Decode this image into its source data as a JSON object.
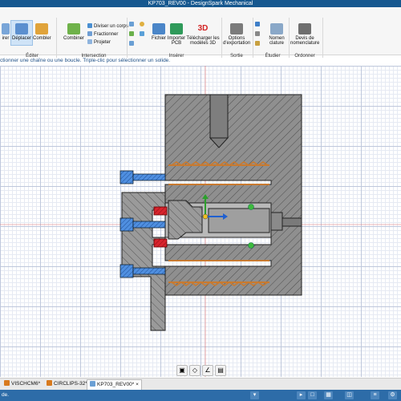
{
  "window": {
    "title": "KP703_REV00 - DesignSpark Mechanical"
  },
  "ribbon": {
    "edit": {
      "tools": [
        {
          "label": "irer"
        },
        {
          "label": "Déplacer"
        },
        {
          "label": "Combler"
        }
      ],
      "group": "Éditer"
    },
    "intersection": {
      "combine": "Combiner",
      "split_body": "Diviser un corps",
      "fractionner": "Fractionner",
      "projeter": "Projeter",
      "group": "Intersection"
    },
    "insert": {
      "fichier": "Fichier",
      "importer_pcb_1": "Importer",
      "importer_pcb_2": "PCB",
      "telecharger_1": "Télécharger les",
      "telecharger_2": "modèles 3D",
      "badge": "3D",
      "group": "Insérer"
    },
    "output": {
      "options_1": "Options",
      "options_2": "d'exportation",
      "group": "Sortie"
    },
    "study": {
      "nomen_1": "Nomen",
      "nomen_2": "clature",
      "group": "Étudier"
    },
    "order": {
      "devis_1": "Devis de",
      "devis_2": "nomenclature",
      "group": "Ordonner"
    }
  },
  "hint": "ctionner une chaîne ou une boucle. Triple-clic pour sélectionner un solide.",
  "tabs": [
    {
      "label": "VISCHCM6*"
    },
    {
      "label": "CIRCLIPS-32*"
    },
    {
      "label": "KP703_REV00*",
      "close": "×"
    }
  ],
  "status": {
    "text": "de."
  },
  "colors": {
    "accent": "#16588f",
    "status_bar": "#2d6ca8",
    "part_grey": "#8f8f8f",
    "screw_blue": "#3f7fd8",
    "spring_orange": "#c87a30",
    "red_part": "#d0202a"
  }
}
